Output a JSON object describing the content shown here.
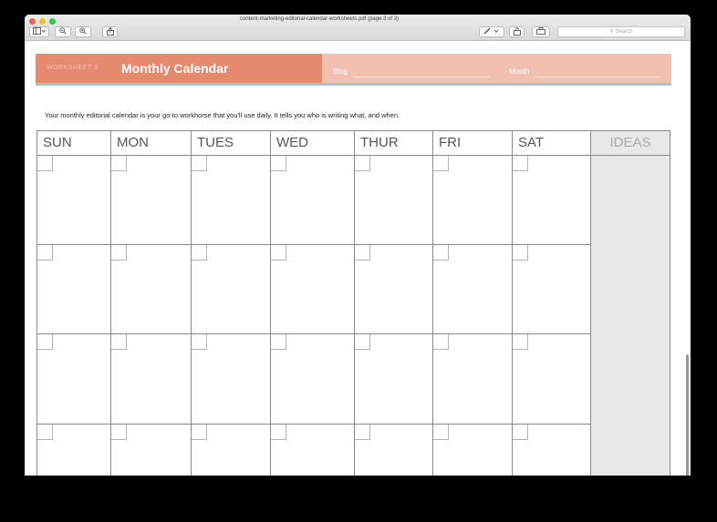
{
  "window": {
    "title": "content-marketing-editorial-calendar-worksheets.pdf (page 3 of 3)",
    "search_placeholder": "Search"
  },
  "toolbar": {
    "sidebar_icon": "sidebar-toggle-icon",
    "zoom_out_icon": "zoom-out-icon",
    "zoom_in_icon": "zoom-in-icon",
    "share_icon": "share-icon",
    "markup_icon": "pen-icon",
    "rotate_icon": "rotate-icon",
    "toolbox_icon": "toolbox-icon"
  },
  "worksheet": {
    "label": "WORKSHEET 3",
    "title": "Monthly Calendar",
    "blog_label": "Blog",
    "month_label": "Month",
    "intro": "Your monthly editorial calendar is your go-to workhorse that you'll use daily. It tells you who is writing what, and when."
  },
  "calendar": {
    "days": [
      "SUN",
      "MON",
      "TUES",
      "WED",
      "THUR",
      "FRI",
      "SAT"
    ],
    "ideas_label": "IDEAS"
  },
  "colors": {
    "header_accent": "#e5896f",
    "header_light": "#f1c0b1",
    "header_underline": "#a9c3cd",
    "ideas_bg": "#e8e8e8"
  }
}
